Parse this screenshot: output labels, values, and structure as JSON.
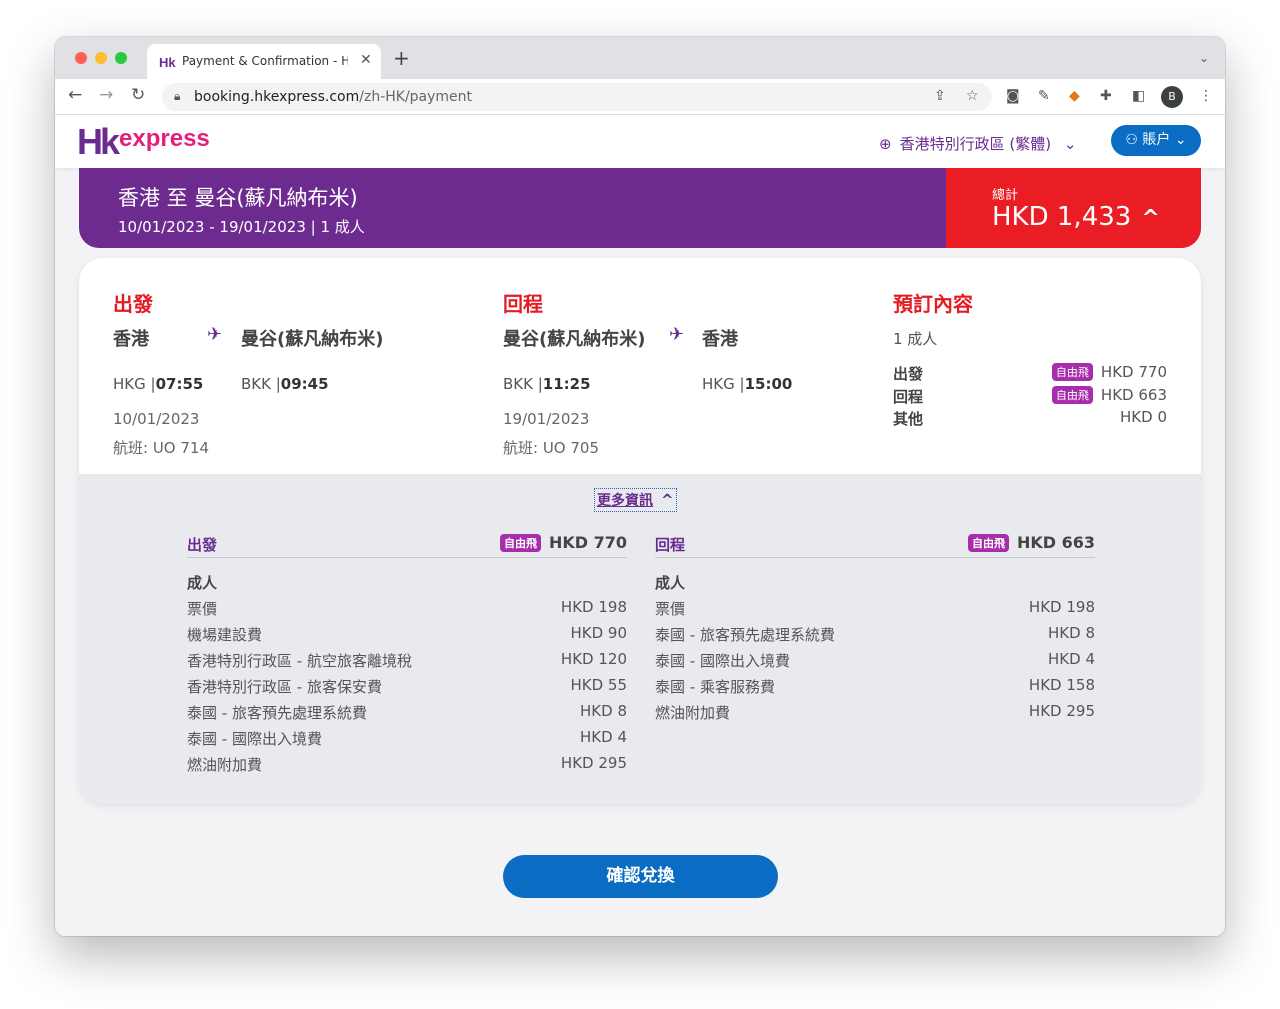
{
  "browser": {
    "tab_title": "Payment & Confirmation - HK Express",
    "url_host": "booking.hkexpress.com",
    "url_path": "/zh-HK/payment",
    "profile_initial": "B"
  },
  "header": {
    "logo_hk": "Hk",
    "logo_express": "express",
    "language": "香港特別行政區 (繁體)",
    "account": "賬户"
  },
  "summary": {
    "route": "香港 至 曼谷(蘇凡納布米)",
    "dates": "10/01/2023 - 19/01/2023 | 1 成人",
    "total_label": "總計",
    "total_value": "HKD 1,433"
  },
  "outbound": {
    "title": "出發",
    "from_city": "香港",
    "to_city": "曼谷(蘇凡納布米)",
    "from_code": "HKG",
    "from_time": "07:55",
    "to_code": "BKK",
    "to_time": "09:45",
    "date": "10/01/2023",
    "flight": "航班: UO 714"
  },
  "return": {
    "title": "回程",
    "from_city": "曼谷(蘇凡納布米)",
    "to_city": "香港",
    "from_code": "BKK",
    "from_time": "11:25",
    "to_code": "HKG",
    "to_time": "15:00",
    "date": "19/01/2023",
    "flight": "航班: UO 705"
  },
  "booking": {
    "title": "預訂內容",
    "passengers": "1 成人",
    "tag": "自由飛",
    "rows": [
      {
        "label": "出發",
        "value": "HKD 770"
      },
      {
        "label": "回程",
        "value": "HKD 663"
      },
      {
        "label": "其他",
        "value": "HKD 0"
      }
    ]
  },
  "details": {
    "more_info": "更多資訊",
    "outbound": {
      "title": "出發",
      "total": "HKD 770",
      "passenger_type": "成人",
      "items": [
        {
          "label": "票價",
          "value": "HKD 198"
        },
        {
          "label": "機場建設費",
          "value": "HKD 90"
        },
        {
          "label": "香港特別行政區 - 航空旅客離境稅",
          "value": "HKD 120"
        },
        {
          "label": "香港特別行政區 - 旅客保安費",
          "value": "HKD 55"
        },
        {
          "label": "泰國 - 旅客預先處理系統費",
          "value": "HKD 8"
        },
        {
          "label": "泰國 - 國際出入境費",
          "value": "HKD 4"
        },
        {
          "label": "燃油附加費",
          "value": "HKD 295"
        }
      ]
    },
    "return": {
      "title": "回程",
      "total": "HKD 663",
      "passenger_type": "成人",
      "items": [
        {
          "label": "票價",
          "value": "HKD 198"
        },
        {
          "label": "泰國 - 旅客預先處理系統費",
          "value": "HKD 8"
        },
        {
          "label": "泰國 - 國際出入境費",
          "value": "HKD 4"
        },
        {
          "label": "泰國 - 乘客服務費",
          "value": "HKD 158"
        },
        {
          "label": "燃油附加費",
          "value": "HKD 295"
        }
      ]
    }
  },
  "confirm_button": "確認兌換",
  "colors": {
    "brand_purple": "#6d2b8f",
    "accent_red": "#ea1d25",
    "action_blue": "#0a6cc2",
    "tag_magenta": "#a72eab"
  }
}
